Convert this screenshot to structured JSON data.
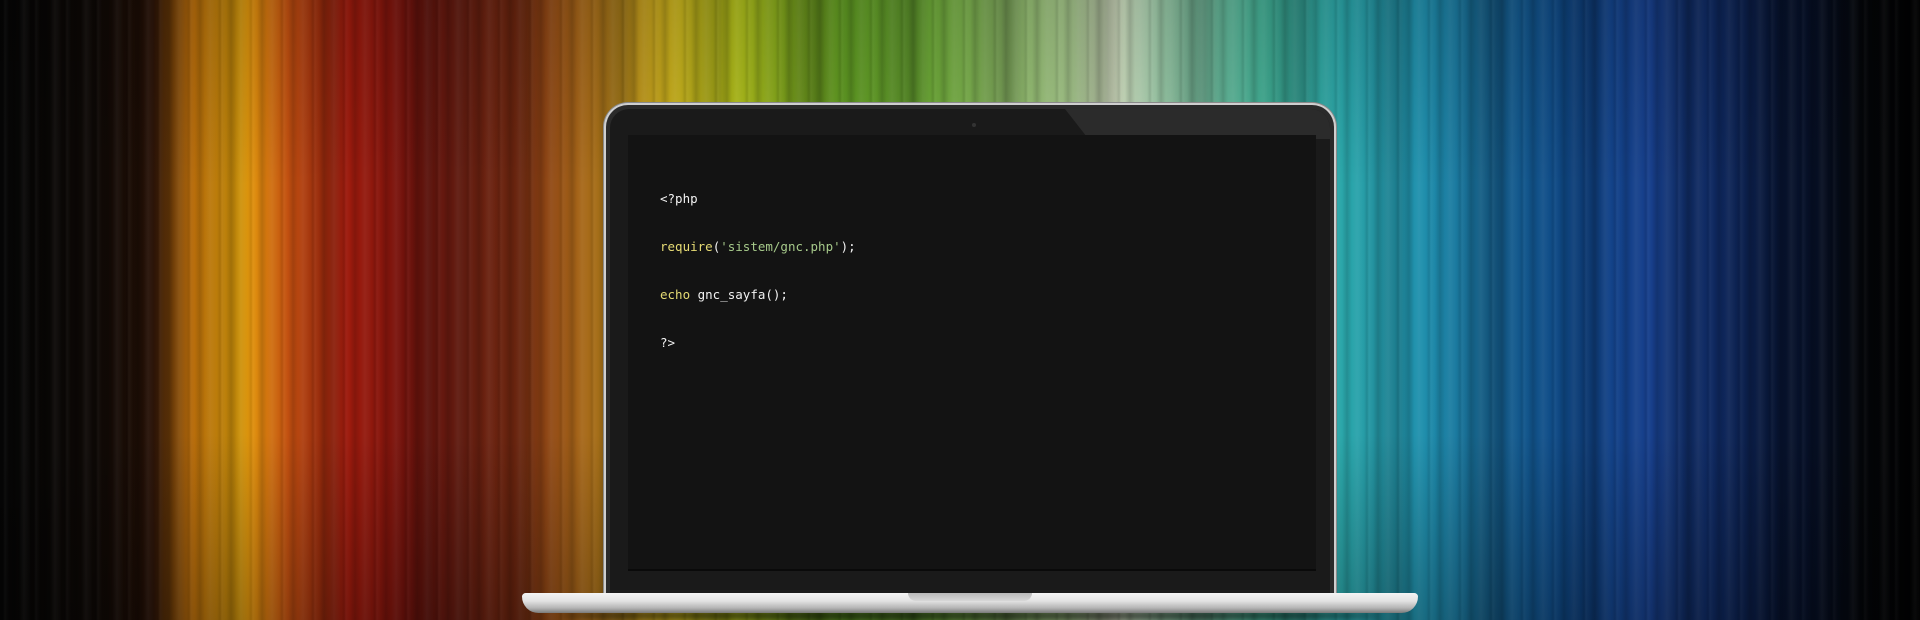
{
  "code_editor": {
    "lines": [
      {
        "parts": [
          {
            "text": "<?php",
            "kind": "plain"
          }
        ]
      },
      {
        "parts": [
          {
            "text": "require",
            "kind": "kw"
          },
          {
            "text": "(",
            "kind": "plain"
          },
          {
            "text": "'sistem/gnc.php'",
            "kind": "str"
          },
          {
            "text": ");",
            "kind": "plain"
          }
        ]
      },
      {
        "parts": [
          {
            "text": "echo",
            "kind": "kw"
          },
          {
            "text": " gnc_sayfa();",
            "kind": "plain"
          }
        ]
      },
      {
        "parts": [
          {
            "text": "?>",
            "kind": "plain"
          }
        ]
      }
    ]
  },
  "colors": {
    "keyword": "#e6db74",
    "string": "#a6c98a",
    "plain": "#f2f2f2",
    "screen_background": "#131313"
  }
}
